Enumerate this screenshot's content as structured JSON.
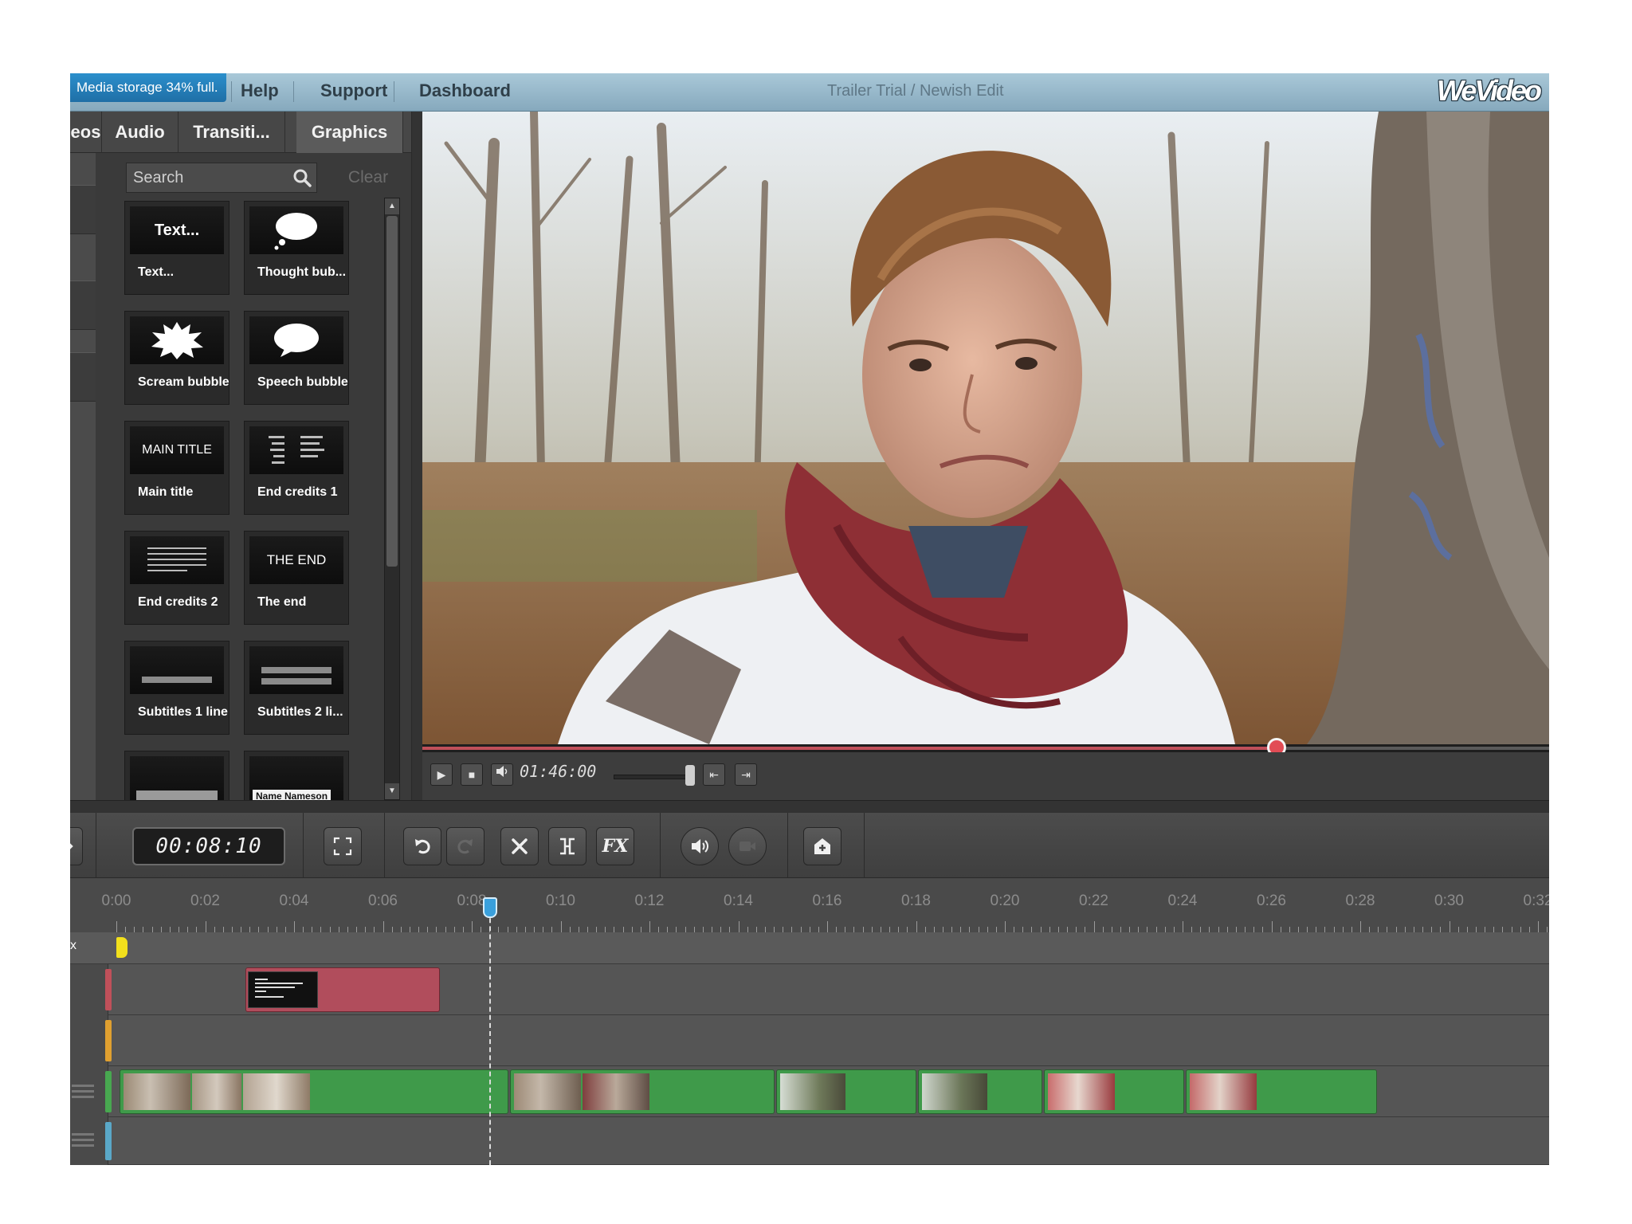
{
  "topbar": {
    "storage_text": "Media storage 34% full.",
    "links": [
      "Help",
      "Support",
      "Dashboard"
    ],
    "project_title": "Trailer Trial / Newish Edit",
    "logo": "WeVideo"
  },
  "leftpanel": {
    "tabs": [
      "eos",
      "Audio",
      "Transiti...",
      "Graphics"
    ],
    "active_tab": "Graphics",
    "search_placeholder": "Search",
    "clear_label": "Clear",
    "items": [
      {
        "thumb": "Text...",
        "label": "Text..."
      },
      {
        "thumb": "",
        "label": "Thought bub..."
      },
      {
        "thumb": "",
        "label": "Scream bubble"
      },
      {
        "thumb": "",
        "label": "Speech bubble"
      },
      {
        "thumb": "MAIN TITLE",
        "label": "Main title"
      },
      {
        "thumb": "",
        "label": "End credits 1"
      },
      {
        "thumb": "",
        "label": "End credits 2"
      },
      {
        "thumb": "THE END",
        "label": "The end"
      },
      {
        "thumb": "",
        "label": "Subtitles 1 line"
      },
      {
        "thumb": "",
        "label": "Subtitles 2 li..."
      },
      {
        "thumb": "",
        "label": ""
      },
      {
        "thumb": "Name Nameson",
        "label": ""
      }
    ]
  },
  "player": {
    "time": "01:46:00",
    "progress": 0.758
  },
  "toolbar": {
    "timecode": "00:08:10",
    "fx_label": "FX",
    "icons": [
      "fullscreen-icon",
      "undo-icon",
      "redo-icon",
      "delete-icon",
      "split-icon",
      "fx-icon",
      "volume-icon",
      "record-icon",
      "add-track-icon"
    ]
  },
  "timeline": {
    "ruler_labels": [
      "0:00",
      "0:02",
      "0:04",
      "0:06",
      "0:08",
      "0:10",
      "0:12",
      "0:14",
      "0:16",
      "0:18",
      "0:20",
      "0:22",
      "0:24",
      "0:26",
      "0:28",
      "0:30",
      "0:32"
    ],
    "playhead_time": "0:08",
    "track_colors": [
      "#c0505a",
      "#e0a030",
      "#48a850",
      "#5aa8c8"
    ]
  },
  "colors": {
    "accent": "#1f6fa6",
    "title_clip": "#b14d5c",
    "video_clip": "#3f9a4a",
    "playhead": "#3aa0dc"
  }
}
